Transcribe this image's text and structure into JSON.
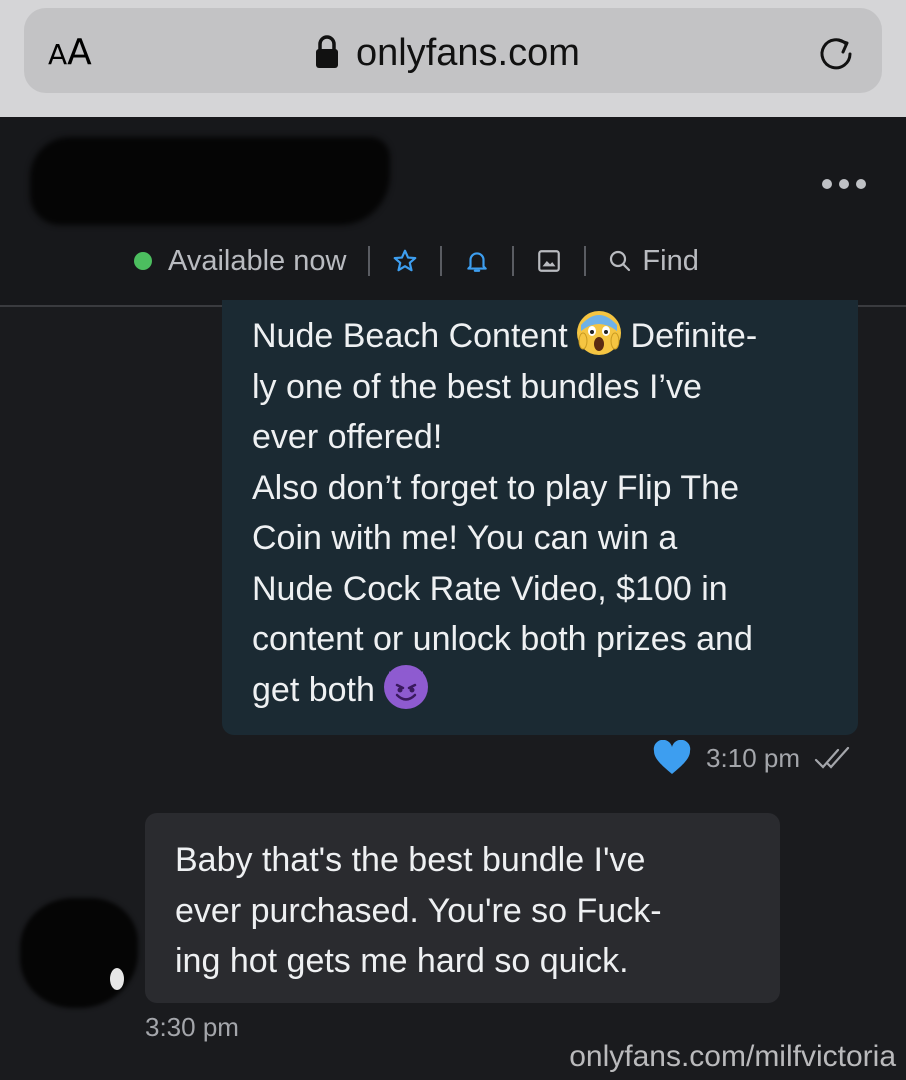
{
  "browser": {
    "aa_small": "A",
    "aa_big": "A",
    "url": "onlyfans.com"
  },
  "header": {
    "status": "Available now",
    "find_label": "Find",
    "status_color": "#4cbe5f"
  },
  "messages": {
    "outgoing": {
      "line1_a": "Nude Beach Content ",
      "line1_b": " Definite-",
      "lines": "ly one of the best bundles I’ve\never offered!\nAlso don’t forget to play Flip The\nCoin with me! You can win a\nNude Cock Rate Video, $100 in\ncontent or unlock both prizes and",
      "last_line": "get both ",
      "time": "3:10 pm",
      "heart_color": "#3d9ef0"
    },
    "incoming": {
      "text": "Baby that's the best bundle I've\never purchased. You're so Fuck-\ning hot gets me hard so quick.",
      "time": "3:30 pm"
    }
  },
  "watermark": "onlyfans.com/milfvictoria"
}
